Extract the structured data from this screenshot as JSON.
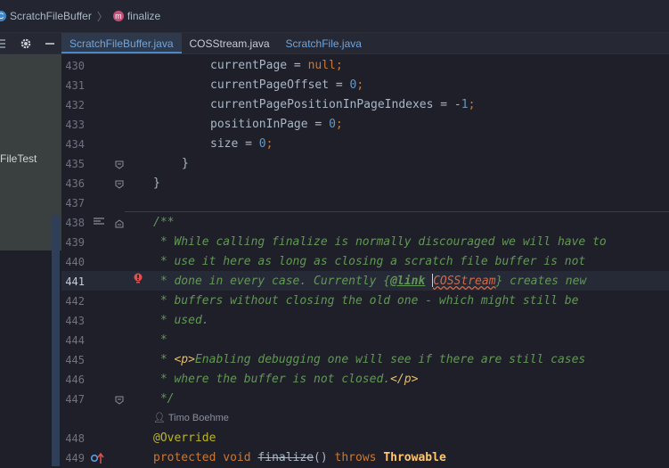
{
  "breadcrumb": {
    "class_name": "ScratchFileBuffer",
    "method_name": "finalize",
    "class_icon": "class-icon",
    "method_icon": "method-icon"
  },
  "left_panel": {
    "tree_item": "FileTest"
  },
  "tabs": [
    {
      "label": "ScratchFileBuffer.java",
      "active": true
    },
    {
      "label": "COSStream.java",
      "active": false
    },
    {
      "label": "ScratchFile.java",
      "active": false
    }
  ],
  "line_numbers": [
    "430",
    "431",
    "432",
    "433",
    "434",
    "435",
    "436",
    "437",
    "438",
    "439",
    "440",
    "441",
    "442",
    "443",
    "444",
    "445",
    "446",
    "447",
    "448",
    "449"
  ],
  "code": {
    "l430_a": "currentPage",
    "l430_b": " = ",
    "l430_c": "null",
    "l430_d": ";",
    "l431_a": "currentPageOffset",
    "l431_b": " = ",
    "l431_c": "0",
    "l431_d": ";",
    "l432_a": "currentPagePositionInPageIndexes",
    "l432_b": " = -",
    "l432_c": "1",
    "l432_d": ";",
    "l433_a": "positionInPage",
    "l433_b": " = ",
    "l433_c": "0",
    "l433_d": ";",
    "l434_a": "size",
    "l434_b": " = ",
    "l434_c": "0",
    "l434_d": ";",
    "l435": "}",
    "l436": "}",
    "l438": "/**",
    "l439": " * While calling finalize is normally discouraged we will have to",
    "l440": " * use it here as long as closing a scratch file buffer is not",
    "l441_a": " * done in every case. Currently {",
    "l441_link": "@link",
    "l441_ref": "COSStream",
    "l441_b": "} creates new",
    "l442": " * buffers without closing the old one - which might still be",
    "l443": " * used.",
    "l444": " *",
    "l445_a": " * ",
    "l445_tag": "<p>",
    "l445_b": "Enabling debugging one will see if there are still cases",
    "l446_a": " * where the buffer is not closed.",
    "l446_tag": "</p>",
    "l447": " */",
    "author": "Timo Boehme",
    "l448": "@Override",
    "l449_kw1": "protected",
    "l449_kw2": "void",
    "l449_name": "finalize",
    "l449_paren": "()",
    "l449_kw3": "throws",
    "l449_type": "Throwable"
  },
  "colors": {
    "accent": "#4a88c7",
    "keyword": "#cc7832",
    "number": "#6897bb",
    "doc_comment": "#629755",
    "error": "#cf6a4c"
  }
}
